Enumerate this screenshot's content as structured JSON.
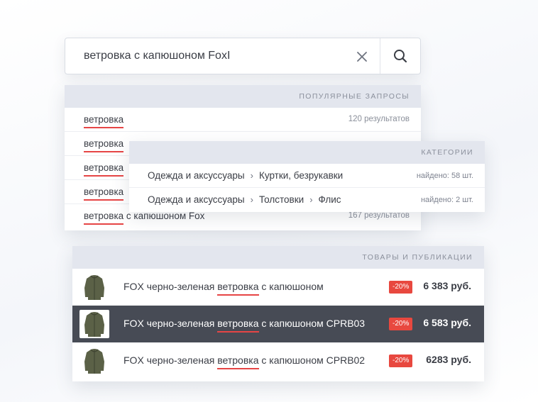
{
  "search": {
    "value": "ветровка с капюшоном FoxI"
  },
  "popular": {
    "header": "ПОПУЛЯРНЫЕ ЗАПРОСЫ",
    "items": [
      {
        "match": "ветровка",
        "rest": "",
        "count": "120 результатов"
      },
      {
        "match": "ветровка",
        "rest": "",
        "count": ""
      },
      {
        "match": "ветровка",
        "rest": "",
        "count": ""
      },
      {
        "match": "ветровка",
        "rest": "",
        "count": ""
      },
      {
        "match": "ветровка",
        "rest": " с капюшоном Fox",
        "count": "167 результатов"
      }
    ]
  },
  "categories": {
    "header": "КАТЕГОРИИ",
    "items": [
      {
        "path": [
          "Одежда и аксуссуары",
          "Куртки, безрукавки"
        ],
        "found": "найдено: 58 шт."
      },
      {
        "path": [
          "Одежда и аксуссуары",
          "Толстовки",
          "Флис"
        ],
        "found": "найдено: 2 шт."
      }
    ]
  },
  "products": {
    "header": "ТОВАРЫ И ПУБЛИКАЦИИ",
    "items": [
      {
        "before": "FOX черно-зеленая ",
        "match": "ветровка",
        "after": " с капюшоном",
        "badge": "-20%",
        "price": "6 383 руб.",
        "active": false
      },
      {
        "before": "FOX черно-зеленая ",
        "match": "ветровка",
        "after": " с капюшоном CPRB03",
        "badge": "-20%",
        "price": "6 583 руб.",
        "active": true
      },
      {
        "before": "FOX черно-зеленая ",
        "match": "ветровка",
        "after": " с капюшоном CPRB02",
        "badge": "-20%",
        "price": "6283 руб.",
        "active": false
      }
    ]
  },
  "colors": {
    "highlight": "#e64545",
    "badge": "#e8483f",
    "active_row": "#474b55",
    "jacket": "#5b6147"
  }
}
